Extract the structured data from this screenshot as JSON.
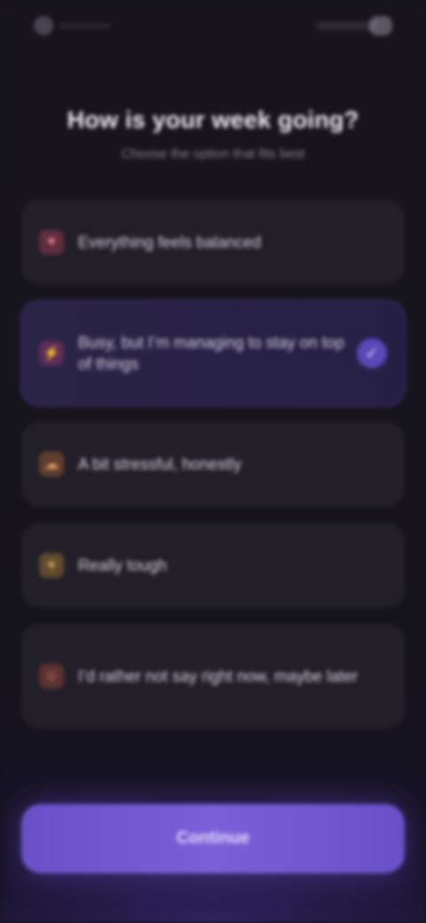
{
  "header": {
    "title": "How is your week going?",
    "subtitle": "Choose the option that fits best"
  },
  "options": [
    {
      "label": "Everything feels balanced",
      "icon": "heart-icon",
      "glyph": "♥",
      "color": "#d14a6b",
      "selected": false
    },
    {
      "label": "Busy, but I’m managing to stay on top of things",
      "icon": "lightning-icon",
      "glyph": "⚡",
      "color": "#c33f7a",
      "selected": true
    },
    {
      "label": "A bit stressful, honestly",
      "icon": "cloud-icon",
      "glyph": "☁",
      "color": "#d07a3a",
      "selected": false
    },
    {
      "label": "Really tough",
      "icon": "sun-icon",
      "glyph": "☀",
      "color": "#d09a3a",
      "selected": false
    },
    {
      "label": "I’d rather not say right now, maybe later",
      "icon": "face-icon",
      "glyph": "☺",
      "color": "#c9563f",
      "selected": false
    }
  ],
  "check_glyph": "✓",
  "continue_label": "Continue"
}
